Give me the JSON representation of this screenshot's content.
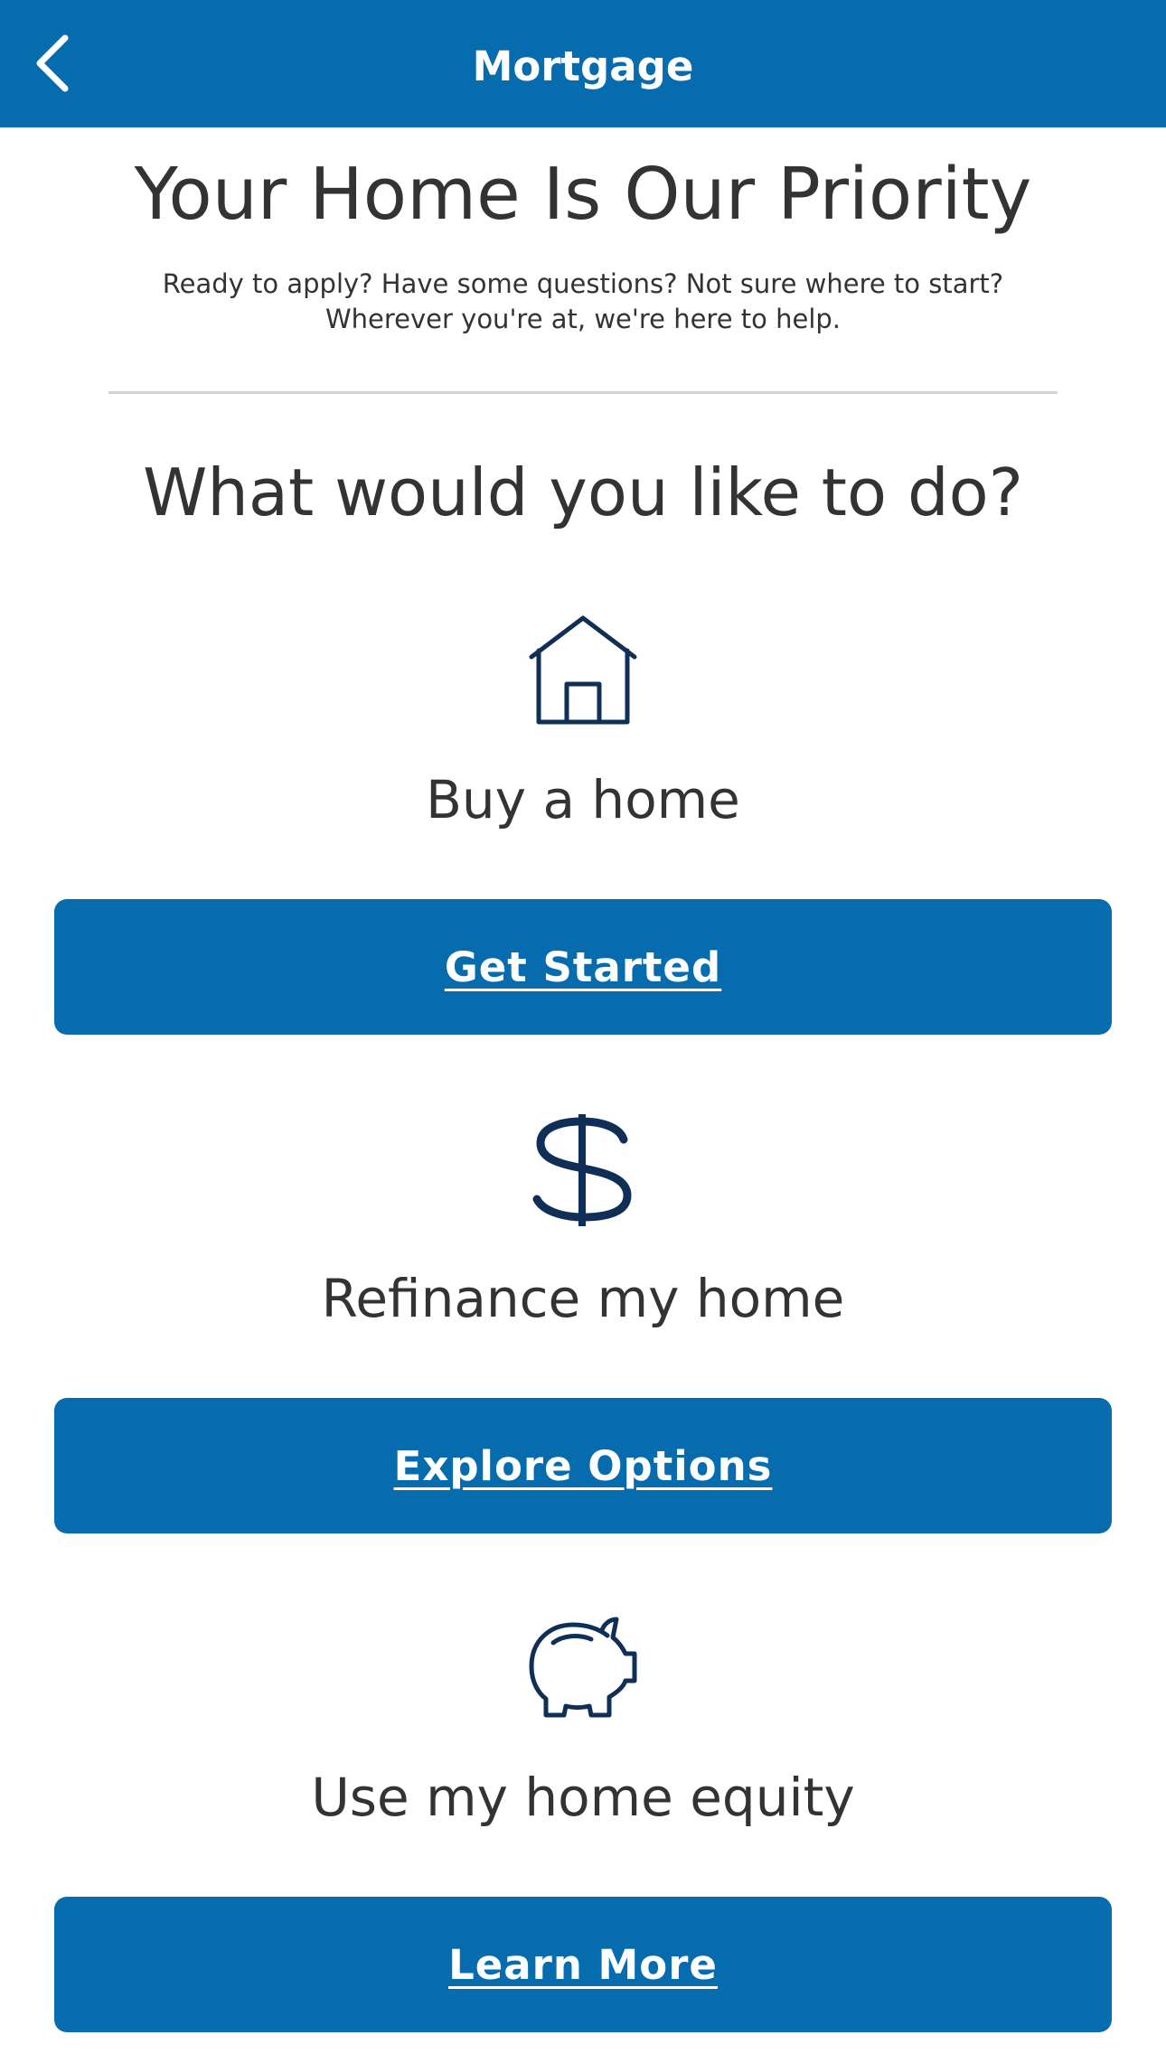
{
  "header": {
    "title": "Mortgage",
    "back_icon": "chevron-left-icon",
    "background": "#066cad"
  },
  "hero": {
    "title": "Your Home Is Our Priority",
    "subtitle_line1": "Ready to apply? Have some questions? Not sure where to start?",
    "subtitle_line2": "Wherever you're at, we're here to help."
  },
  "question": "What would you like to do?",
  "options": [
    {
      "icon": "house-icon",
      "label": "Buy a home",
      "button_label": "Get Started"
    },
    {
      "icon": "dollar-icon",
      "label": "Refinance my home",
      "button_label": "Explore Options"
    },
    {
      "icon": "piggy-bank-icon",
      "label": "Use my home equity",
      "button_label": "Learn More"
    }
  ],
  "colors": {
    "brand_blue": "#066cad",
    "icon_navy": "#0f2f57",
    "text": "#333333",
    "divider": "#d4d4d4"
  }
}
